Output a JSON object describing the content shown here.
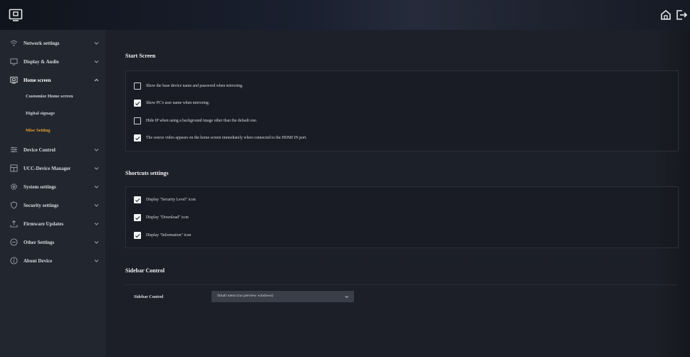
{
  "sidebar": {
    "items": [
      {
        "label": "Network settings",
        "icon": "wifi-icon"
      },
      {
        "label": "Display & Audio",
        "icon": "monitor-icon"
      },
      {
        "label": "Home screen",
        "icon": "home-screen-icon",
        "expanded": true,
        "subitems": [
          {
            "label": "Customize Home screen",
            "active": false
          },
          {
            "label": "Digital signage",
            "active": false
          },
          {
            "label": "Misc Setting",
            "active": true
          }
        ]
      },
      {
        "label": "Device Control",
        "icon": "sliders-icon"
      },
      {
        "label": "UCC-Device Manager",
        "icon": "device-manager-icon"
      },
      {
        "label": "System settings",
        "icon": "gear-icon"
      },
      {
        "label": "Security settings",
        "icon": "shield-icon"
      },
      {
        "label": "Firmware Updates",
        "icon": "upload-icon"
      },
      {
        "label": "Other Settings",
        "icon": "more-icon"
      },
      {
        "label": "About Device",
        "icon": "info-icon"
      }
    ]
  },
  "start_screen": {
    "title": "Start Screen",
    "options": [
      {
        "label": "Show the base device name and password when mirroring.",
        "checked": false
      },
      {
        "label": "Show PC's user name when mirroring.",
        "checked": true
      },
      {
        "label": "Hide IP when using a background image other than the default one.",
        "checked": false
      },
      {
        "label": "The source video appears on the home screen immediately when connected to the HDMI IN port.",
        "checked": true
      }
    ]
  },
  "shortcuts": {
    "title": "Shortcuts settings",
    "options": [
      {
        "label": "Display \"Security Level\" icon",
        "checked": true
      },
      {
        "label": "Display \"Download\" icon",
        "checked": true
      },
      {
        "label": "Display \"Information\" icon",
        "checked": true
      }
    ]
  },
  "sidebar_control": {
    "title": "Sidebar Control",
    "field_label": "Sidebar Control",
    "selected": "Small menu (no preview windows)"
  },
  "colors": {
    "accent": "#e5a52b",
    "background": "#1a1d24",
    "sidebar": "#22262f"
  }
}
